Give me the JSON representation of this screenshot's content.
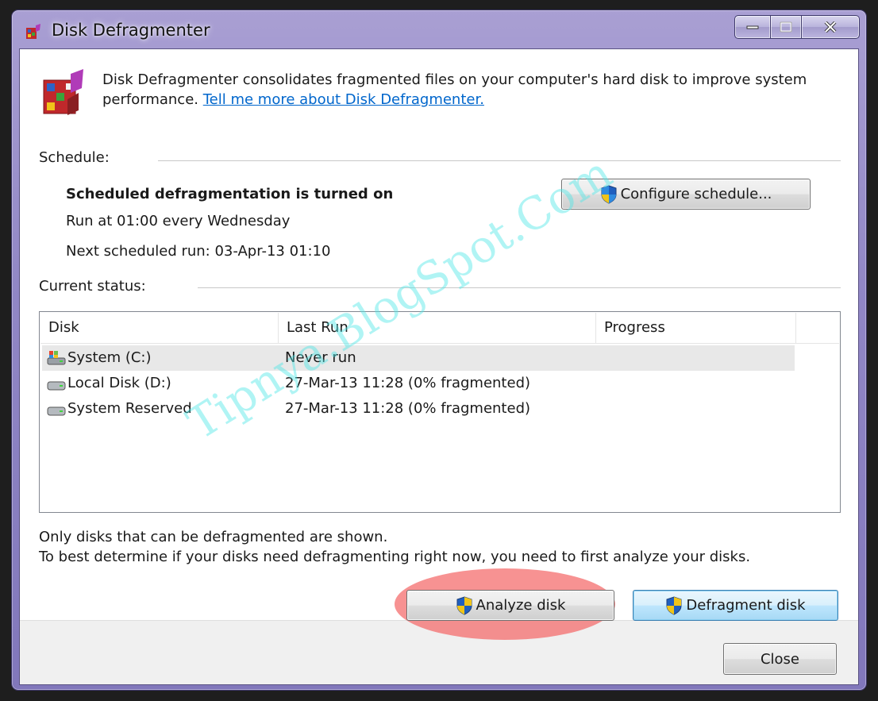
{
  "window": {
    "title": "Disk Defragmenter",
    "icon": "defrag-app-icon",
    "caption_buttons": [
      "minimize",
      "maximize",
      "close"
    ]
  },
  "intro": {
    "text": "Disk Defragmenter consolidates fragmented files on your computer's hard disk to improve system performance.",
    "link": "Tell me more about Disk Defragmenter."
  },
  "schedule": {
    "label": "Schedule:",
    "status": "Scheduled defragmentation is turned on",
    "run_at": "Run at 01:00 every Wednesday",
    "next_run": "Next scheduled run: 03-Apr-13 01:10",
    "configure_button": "Configure schedule..."
  },
  "current_status": {
    "label": "Current status:",
    "columns": [
      "Disk",
      "Last Run",
      "Progress"
    ],
    "rows": [
      {
        "disk": "System (C:)",
        "last_run": "Never run",
        "progress": "",
        "icon": "system-drive-icon",
        "selected": true
      },
      {
        "disk": "Local Disk (D:)",
        "last_run": "27-Mar-13 11:28 (0% fragmented)",
        "progress": "",
        "icon": "hard-drive-icon",
        "selected": false
      },
      {
        "disk": "System Reserved",
        "last_run": "27-Mar-13 11:28 (0% fragmented)",
        "progress": "",
        "icon": "hard-drive-icon",
        "selected": false
      }
    ]
  },
  "info": {
    "line1": "Only disks that can be defragmented are shown.",
    "line2": "To best determine if your disks need defragmenting right now, you need to first analyze your disks."
  },
  "buttons": {
    "analyze": "Analyze disk",
    "defragment": "Defragment disk",
    "close": "Close"
  },
  "watermark": "Tipnya.BlogSpot.Com",
  "colors": {
    "title_bar": "#9187c6",
    "link": "#0066cc",
    "highlight": "#f46e6e",
    "watermark": "#50e6e6"
  }
}
